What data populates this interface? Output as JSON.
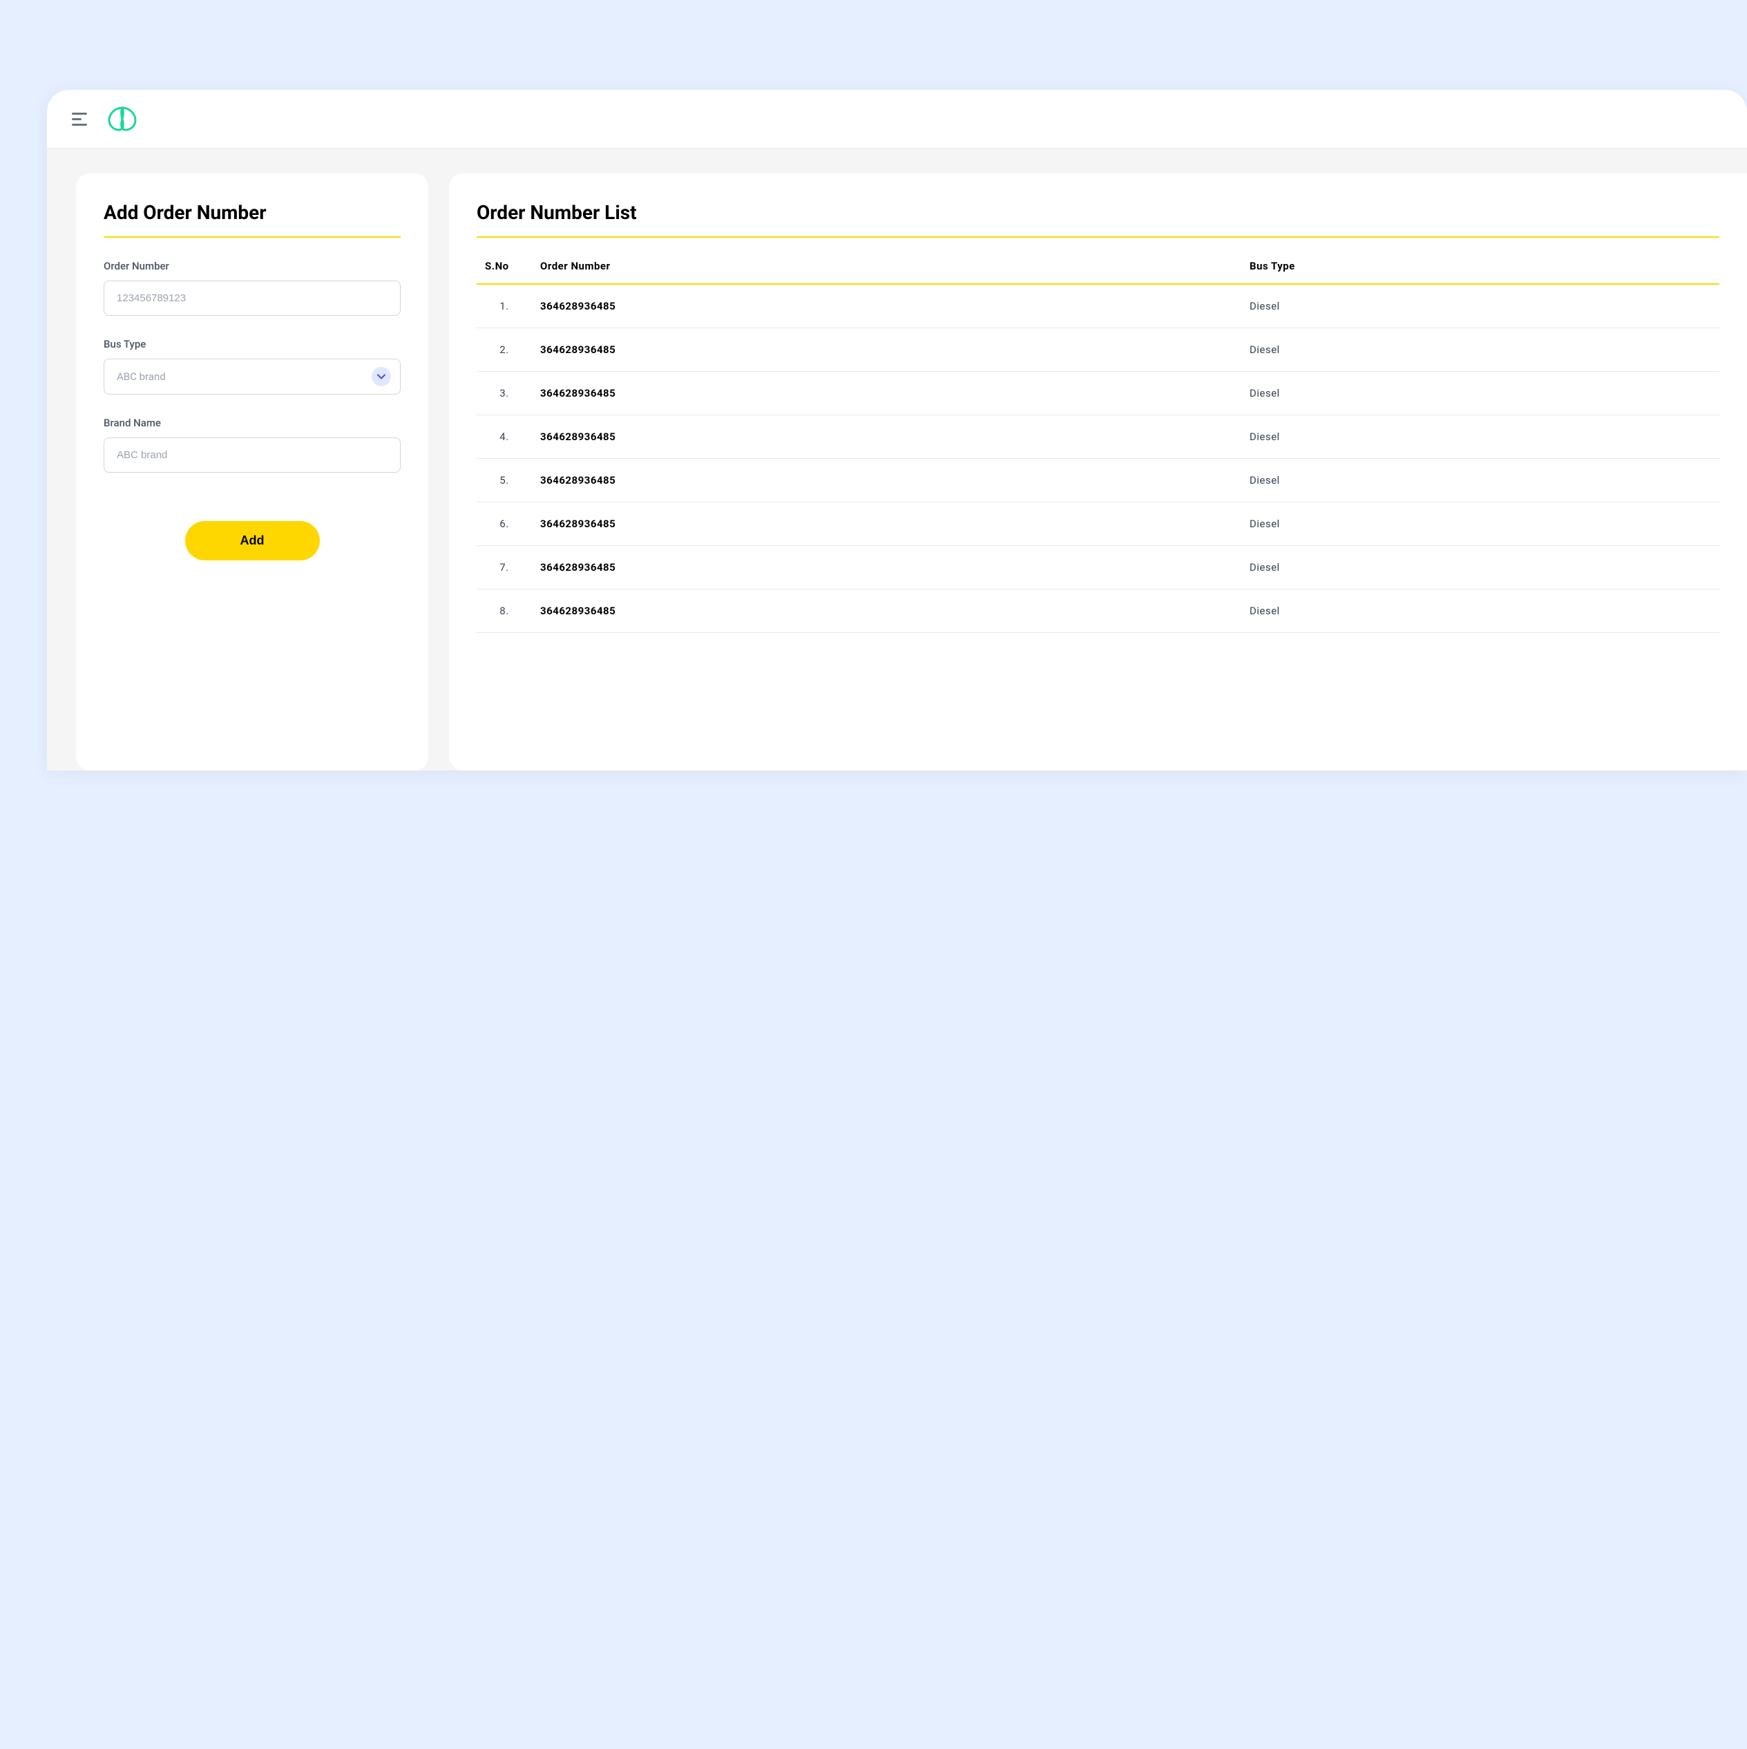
{
  "header": {
    "menuLabel": "Menu",
    "logoLabel": "Logo"
  },
  "addForm": {
    "title": "Add Order Number",
    "fields": {
      "orderNumber": {
        "label": "Order Number",
        "placeholder": "123456789123"
      },
      "busType": {
        "label": "Bus Type",
        "placeholder": "ABC brand"
      },
      "brandName": {
        "label": "Brand Name",
        "placeholder": "ABC brand"
      }
    },
    "submitLabel": "Add"
  },
  "orderList": {
    "title": "Order Number List",
    "columns": {
      "sno": "S.No",
      "orderNumber": "Order Number",
      "busType": "Bus Type"
    },
    "rows": [
      {
        "sno": "1.",
        "orderNumber": "364628936485",
        "busType": "Diesel"
      },
      {
        "sno": "2.",
        "orderNumber": "364628936485",
        "busType": "Diesel"
      },
      {
        "sno": "3.",
        "orderNumber": "364628936485",
        "busType": "Diesel"
      },
      {
        "sno": "4.",
        "orderNumber": "364628936485",
        "busType": "Diesel"
      },
      {
        "sno": "5.",
        "orderNumber": "364628936485",
        "busType": "Diesel"
      },
      {
        "sno": "6.",
        "orderNumber": "364628936485",
        "busType": "Diesel"
      },
      {
        "sno": "7.",
        "orderNumber": "364628936485",
        "busType": "Diesel"
      },
      {
        "sno": "8.",
        "orderNumber": "364628936485",
        "busType": "Diesel"
      }
    ]
  }
}
